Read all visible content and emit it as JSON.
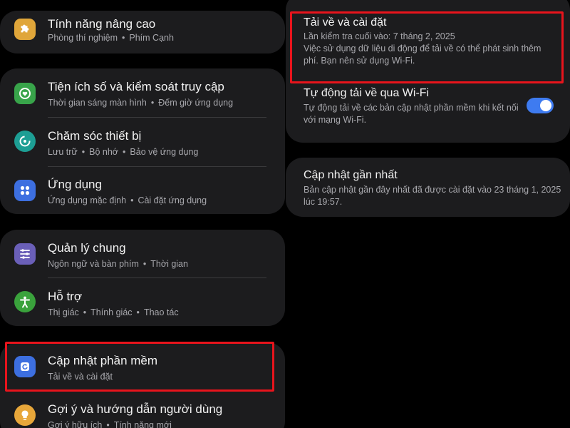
{
  "left": {
    "advanced": {
      "title": "Tính năng nâng cao",
      "subtitle": [
        "Phòng thí nghiệm",
        "Phím Cạnh"
      ],
      "icon": "puzzle-icon",
      "color": "#e0a63a"
    },
    "wellbeing": {
      "title": "Tiện ích số và kiểm soát truy cập",
      "subtitle": [
        "Thời gian sáng màn hình",
        "Đếm giờ ứng dụng"
      ],
      "icon": "heart-ring-icon",
      "color": "#38a44a"
    },
    "device_care": {
      "title": "Chăm sóc thiết bị",
      "subtitle": [
        "Lưu trữ",
        "Bộ nhớ",
        "Bảo vệ ứng dụng"
      ],
      "icon": "refresh-ring-icon",
      "color": "#1d9e94"
    },
    "apps": {
      "title": "Ứng dụng",
      "subtitle": [
        "Ứng dụng mặc định",
        "Cài đặt ứng dụng"
      ],
      "icon": "four-dots-icon",
      "color": "#3d6fe0"
    },
    "general": {
      "title": "Quản lý chung",
      "subtitle": [
        "Ngôn ngữ và bàn phím",
        "Thời gian"
      ],
      "icon": "sliders-icon",
      "color": "#6a5fb8"
    },
    "accessibility": {
      "title": "Hỗ trợ",
      "subtitle": [
        "Thị giác",
        "Thính giác",
        "Thao tác"
      ],
      "icon": "accessibility-person-icon",
      "color": "#3aa23c"
    },
    "software_update": {
      "title": "Cập nhật phần mềm",
      "subtitle": [
        "Tải về và cài đặt"
      ],
      "icon": "update-icon",
      "color": "#3d6fe0"
    },
    "tips": {
      "title": "Gợi ý và hướng dẫn người dùng",
      "subtitle": [
        "Gợi ý hữu ích",
        "Tính năng mới"
      ],
      "icon": "lightbulb-icon",
      "color": "#e8a73a"
    }
  },
  "right": {
    "download_install": {
      "title": "Tải về và cài đặt",
      "last_checked": "Lần kiểm tra cuối vào: 7 tháng 2, 2025",
      "note_line1": "Việc sử dụng dữ liệu di động để tải về có thể phát sinh thêm",
      "note_line2": "phí. Bạn nên sử dụng Wi-Fi."
    },
    "auto_wifi": {
      "title": "Tự động tải về qua Wi-Fi",
      "desc_line1": "Tự động tải về các bản cập nhật phần mềm khi kết nối",
      "desc_line2": "với mạng Wi-Fi.",
      "enabled": true,
      "toggle_color": "#3e7bf0"
    },
    "last_update": {
      "title": "Cập nhật gần nhất",
      "desc_line1": "Bản cập nhật gần đây nhất đã được cài đặt vào 23 tháng 1, 2025",
      "desc_line2": "lúc 19:57."
    }
  },
  "highlight_color": "#e8141c",
  "separator": "•"
}
